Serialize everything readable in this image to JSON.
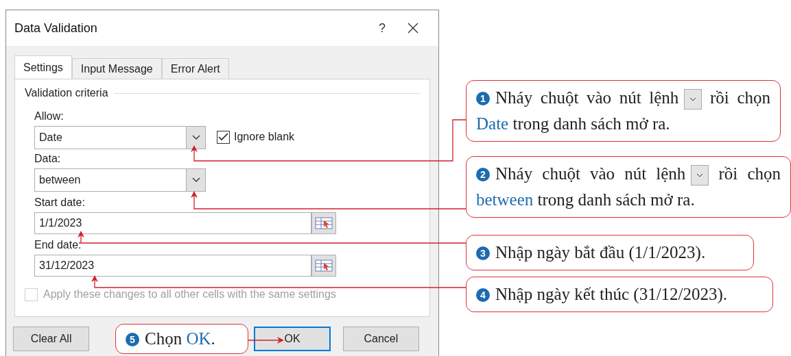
{
  "dialog": {
    "title": "Data Validation",
    "help": "?",
    "tabs": [
      {
        "label": "Settings",
        "selected": true
      },
      {
        "label": "Input Message",
        "selected": false
      },
      {
        "label": "Error Alert",
        "selected": false
      }
    ],
    "section": "Validation criteria",
    "allow": {
      "label": "Allow:",
      "value": "Date"
    },
    "ignore_blank": {
      "label": "Ignore blank",
      "checked": true
    },
    "data": {
      "label": "Data:",
      "value": "between"
    },
    "start_date": {
      "label": "Start date:",
      "value": "1/1/2023"
    },
    "end_date": {
      "label": "End date:",
      "value": "31/12/2023"
    },
    "apply_all": {
      "label": "Apply these changes to all other cells with the same settings",
      "checked": false,
      "disabled": true
    },
    "buttons": [
      {
        "label": "Clear All",
        "default": false
      },
      {
        "label": "OK",
        "default": true
      },
      {
        "label": "Cancel",
        "default": false
      }
    ]
  },
  "callouts": [
    {
      "number": "1",
      "parts": [
        {
          "kind": "text",
          "text": "Nháy chuột vào nút lệnh"
        },
        {
          "kind": "button"
        },
        {
          "kind": "text",
          "text": "rồi chọn"
        },
        {
          "kind": "highlight",
          "text": "Date"
        },
        {
          "kind": "text",
          "text": "trong danh sách mở ra."
        }
      ]
    },
    {
      "number": "2",
      "parts": [
        {
          "kind": "text",
          "text": "Nháy chuột vào nút lệnh"
        },
        {
          "kind": "button"
        },
        {
          "kind": "text",
          "text": "rồi chọn"
        },
        {
          "kind": "highlight",
          "text": "between"
        },
        {
          "kind": "text",
          "text": "trong danh sách mở ra."
        }
      ]
    },
    {
      "number": "3",
      "parts": [
        {
          "kind": "text",
          "text": "Nhập ngày bắt đầu (1/1/2023)."
        }
      ]
    },
    {
      "number": "4",
      "parts": [
        {
          "kind": "text",
          "text": "Nhập ngày kết thúc (31/12/2023)."
        }
      ]
    },
    {
      "number": "5",
      "parts": [
        {
          "kind": "text",
          "text": "Chọn"
        },
        {
          "kind": "highlight",
          "text": "OK"
        },
        {
          "kind": "punct",
          "text": "."
        }
      ]
    }
  ]
}
